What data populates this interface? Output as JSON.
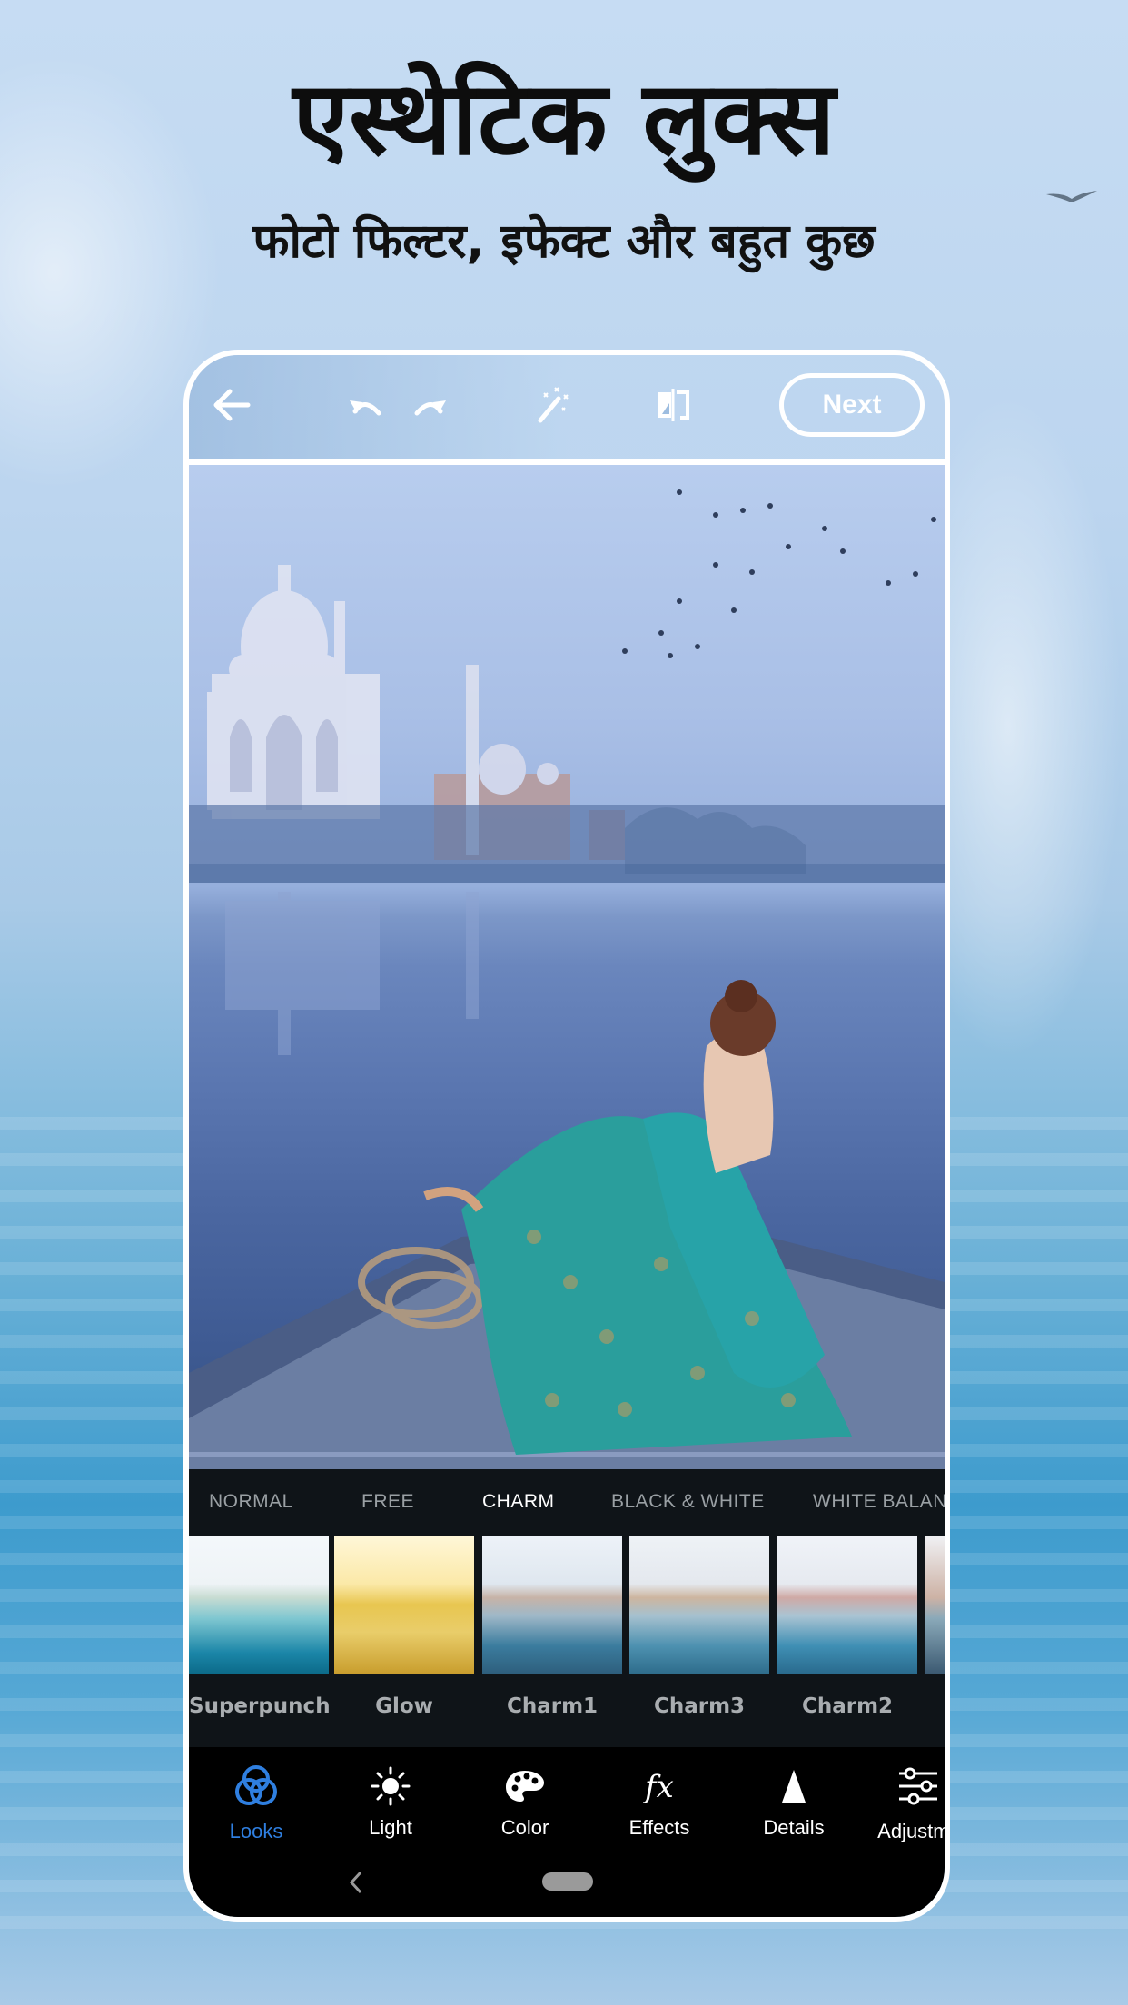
{
  "promo": {
    "headline": "एस्थेटिक लुक्स",
    "subheadline": "फोटो फिल्टर, इफेक्ट और बहुत कुछ"
  },
  "toolbar": {
    "icons": [
      "back-arrow-icon",
      "undo-icon",
      "redo-icon",
      "magic-wand-icon",
      "compare-icon"
    ],
    "next_label": "Next"
  },
  "categories": {
    "items": [
      "NORMAL",
      "FREE",
      "CHARM",
      "BLACK & WHITE",
      "WHITE BALAN"
    ],
    "selected": "CHARM"
  },
  "presets": {
    "items": [
      {
        "label": "Superpunch",
        "tone": "teal-bright"
      },
      {
        "label": "Glow",
        "tone": "yellow"
      },
      {
        "label": "Charm1",
        "tone": "teal-soft"
      },
      {
        "label": "Charm3",
        "tone": "teal-warm"
      },
      {
        "label": "Charm2",
        "tone": "teal-pink"
      }
    ]
  },
  "bottom_nav": {
    "items": [
      {
        "label": "Looks",
        "icon": "looks-circles-icon",
        "active": true
      },
      {
        "label": "Light",
        "icon": "sun-icon",
        "active": false
      },
      {
        "label": "Color",
        "icon": "palette-icon",
        "active": false
      },
      {
        "label": "Effects",
        "icon": "fx-icon",
        "active": false
      },
      {
        "label": "Details",
        "icon": "triangle-icon",
        "active": false
      },
      {
        "label": "Adjustme",
        "icon": "sliders-icon",
        "active": false
      }
    ],
    "active_color": "#2f7fe0"
  }
}
